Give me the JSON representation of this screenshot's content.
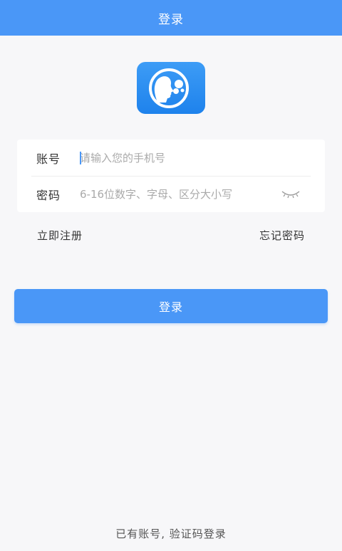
{
  "header": {
    "title": "登录"
  },
  "logo": {
    "icon": "chat-head-logo-icon",
    "color": "#1e82ec"
  },
  "form": {
    "account": {
      "label": "账号",
      "value": "",
      "placeholder": "请输入您的手机号"
    },
    "password": {
      "label": "密码",
      "value": "",
      "placeholder": "6-16位数字、字母、区分大小写",
      "toggle_icon": "eye-closed-icon"
    }
  },
  "links": {
    "register": "立即注册",
    "forgot": "忘记密码"
  },
  "login_button": {
    "label": "登录"
  },
  "footer": {
    "alt_login": "已有账号, 验证码登录"
  },
  "colors": {
    "accent": "#4a97f7",
    "background": "#f7f7f9"
  }
}
